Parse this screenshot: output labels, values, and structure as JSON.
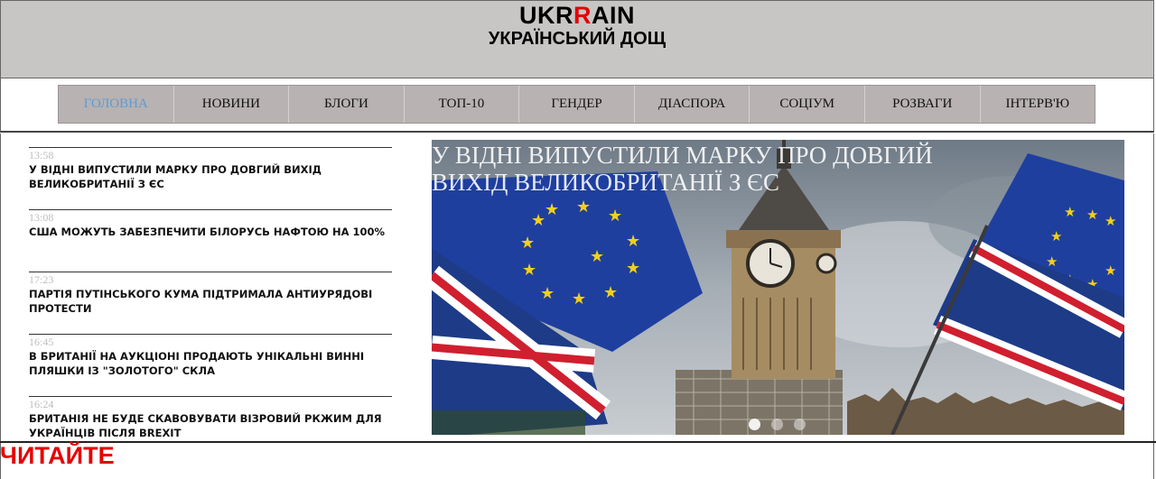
{
  "header": {
    "logo_part1": "UKR",
    "logo_accent": "R",
    "logo_part2": "AIN",
    "tagline": "УКРАЇНСЬКИЙ ДОЩ"
  },
  "nav": {
    "items": [
      {
        "label": "ГОЛОВНА"
      },
      {
        "label": "НОВИНИ"
      },
      {
        "label": "БЛОГИ"
      },
      {
        "label": "ТОП-10"
      },
      {
        "label": "ГЕНДЕР"
      },
      {
        "label": "ДІАСПОРА"
      },
      {
        "label": "СОЦІУМ"
      },
      {
        "label": "РОЗВАГИ"
      },
      {
        "label": "ІНТЕРВ'Ю"
      }
    ],
    "active_index": 0
  },
  "news": [
    {
      "time": "13:58",
      "title": "У Відні випустили марку про довгий вихід Великобританії з ЄС"
    },
    {
      "time": "13:08",
      "title": "США можуть забезпечити Білорусь нафтою на 100%"
    },
    {
      "time": "17:23",
      "title": "Партія путінського кума підтримала антиурядові протести"
    },
    {
      "time": "16:45",
      "title": "В Британії на аукціоні продають унікальні винні пляшки із \"золотого\" скла"
    },
    {
      "time": "16:24",
      "title": "Британія не буде скавовувати візровий ркжим для українців після Brexit"
    }
  ],
  "slider": {
    "caption": "У ВІДНІ ВИПУСТИЛИ МАРКУ ПРО ДОВГИЙ ВИХІД ВЕЛИКОБРИТАНІЇ З ЄС",
    "slide_count": 3,
    "active_slide": 0
  },
  "section": {
    "title": "ЧИТАЙТЕ"
  },
  "colors": {
    "header_bg": "#c8c6c5",
    "nav_bg": "#b8b2b2",
    "accent_red": "#e60000",
    "active_link": "#5b9bd5"
  }
}
